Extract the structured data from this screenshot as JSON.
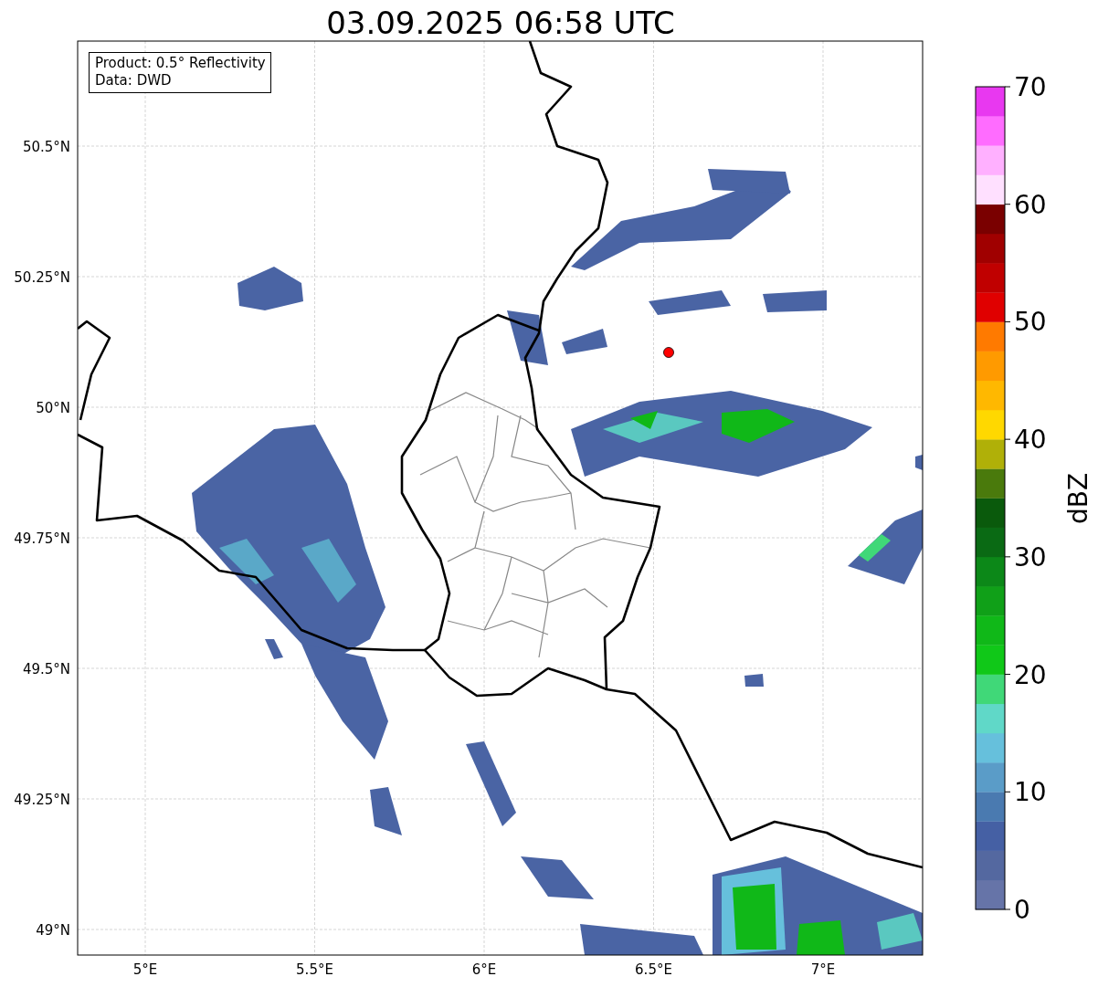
{
  "title": "03.09.2025 06:58 UTC",
  "map": {
    "info_box": [
      "Product: 0.5° Reflectivity",
      "Data: DWD"
    ],
    "lat_ticks": [
      "50.5°N",
      "50.25°N",
      "50°N",
      "49.75°N",
      "49.5°N",
      "49.25°N",
      "49°N"
    ],
    "lon_ticks": [
      "5°E",
      "5.5°E",
      "6°E",
      "6.5°E",
      "7°E"
    ]
  },
  "colorbar": {
    "label": "dBZ",
    "ticks": [
      "70",
      "60",
      "50",
      "40",
      "30",
      "20",
      "10",
      "0"
    ],
    "bins": [
      {
        "color": "#6674a8"
      },
      {
        "color": "#5468a0"
      },
      {
        "color": "#4560a4"
      },
      {
        "color": "#4a7ab0"
      },
      {
        "color": "#5a9cc8"
      },
      {
        "color": "#66c0dc"
      },
      {
        "color": "#60d8c8"
      },
      {
        "color": "#40d878"
      },
      {
        "color": "#10c818"
      },
      {
        "color": "#10b818"
      },
      {
        "color": "#10a018"
      },
      {
        "color": "#0c8818"
      },
      {
        "color": "#0a6a14"
      },
      {
        "color": "#0a5a0c"
      },
      {
        "color": "#4a7a0c"
      },
      {
        "color": "#b0b008"
      },
      {
        "color": "#ffd800"
      },
      {
        "color": "#ffb800"
      },
      {
        "color": "#ff9a00"
      },
      {
        "color": "#ff7a00"
      },
      {
        "color": "#e00000"
      },
      {
        "color": "#c00000"
      },
      {
        "color": "#a00000"
      },
      {
        "color": "#7a0000"
      },
      {
        "color": "#ffe0ff"
      },
      {
        "color": "#ffb0ff"
      },
      {
        "color": "#ff6cff"
      },
      {
        "color": "#e838f0"
      }
    ]
  }
}
